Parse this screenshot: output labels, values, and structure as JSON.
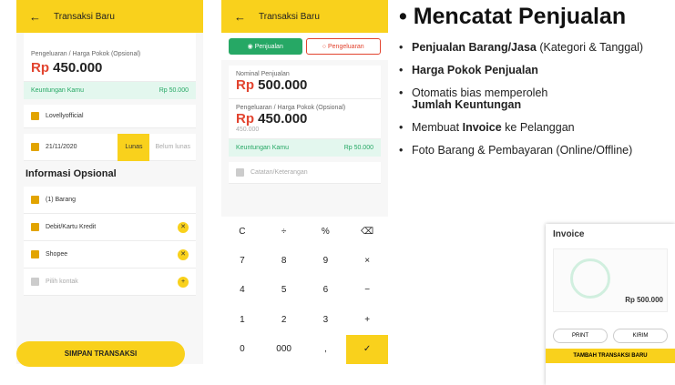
{
  "screen1": {
    "appbar_title": "Transaksi Baru",
    "cost_label": "Pengeluaran / Harga Pokok (Opsional)",
    "cost_currency": "Rp",
    "cost_value": "450.000",
    "profit_label": "Keuntungan Kamu",
    "profit_value": "Rp 50.000",
    "store": "Lovellyofficial",
    "date": "21/11/2020",
    "status_paid": "Lunas",
    "status_unpaid": "Belum lunas",
    "optional_header": "Informasi Opsional",
    "items": "(1) Barang",
    "payment": "Debit/Kartu Kredit",
    "channel": "Shopee",
    "contact_placeholder": "Pilih kontak",
    "save_button": "SIMPAN TRANSAKSI"
  },
  "screen2": {
    "appbar_title": "Transaksi Baru",
    "tab_sale": "Penjualan",
    "tab_expense": "Pengeluaran",
    "sale_label": "Nominal Penjualan",
    "sale_currency": "Rp",
    "sale_value": "500.000",
    "cost_label": "Pengeluaran / Harga Pokok (Opsional)",
    "cost_currency": "Rp",
    "cost_value": "450.000",
    "cost_sub": "450.000",
    "profit_label": "Keuntungan Kamu",
    "profit_value": "Rp 50.000",
    "note_placeholder": "Catatan/Keterangan",
    "keys": [
      "C",
      "÷",
      "%",
      "⌫",
      "7",
      "8",
      "9",
      "×",
      "4",
      "5",
      "6",
      "−",
      "1",
      "2",
      "3",
      "+",
      "0",
      "000",
      ",",
      "✓"
    ]
  },
  "slide": {
    "title": "Mencatat Penjualan",
    "b1_bold": "Penjualan Barang/Jasa",
    "b1_rest": "(Kategori & Tanggal)",
    "b2_bold": "Harga Pokok Penjualan",
    "b3_rest": "Otomatis bias memperoleh",
    "b3_bold": "Jumlah Keuntungan",
    "b4_pre": "Membuat",
    "b4_bold": "Invoice",
    "b4_rest": "ke Pelanggan",
    "b5": "Foto Barang & Pembayaran (Online/Offline)"
  },
  "invoice": {
    "title": "Invoice",
    "amount": "Rp 500.000",
    "print": "PRINT",
    "send": "KIRIM",
    "add": "TAMBAH TRANSAKSI BARU"
  },
  "colors": {
    "accent": "#f9d11c",
    "green": "#26a865",
    "red": "#e2442f"
  }
}
